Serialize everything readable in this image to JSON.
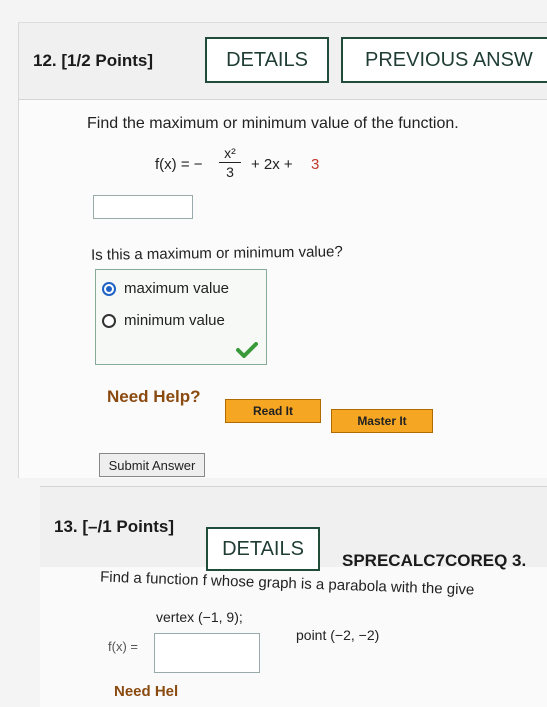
{
  "q12": {
    "label": "12. [1/2 Points]",
    "details_btn": "DETAILS",
    "previous_btn": "PREVIOUS ANSW",
    "prompt": "Find the maximum or minimum value of the function.",
    "fn_prefix": "f(x) = −",
    "fn_num": "x²",
    "fn_den": "3",
    "fn_mid": "+ 2x +",
    "fn_const": "3",
    "answer_value": "",
    "mc_question": "Is this a maximum or minimum value?",
    "options": [
      {
        "label": "maximum value",
        "selected": true
      },
      {
        "label": "minimum value",
        "selected": false
      }
    ],
    "need_help": "Need Help?",
    "read_it": "Read It",
    "master_it": "Master It",
    "submit": "Submit Answer"
  },
  "q13": {
    "label": "13. [–/1 Points]",
    "details_btn": "DETAILS",
    "course": "SPRECALC7COREQ 3.",
    "prompt": "Find a function f whose graph is a parabola with the give",
    "vertex": "vertex (−1, 9);",
    "point": "point (−2, −2)",
    "fx_label": "f(x) =",
    "answer_value": "",
    "need_help": "Need Hel"
  },
  "colors": {
    "accent": "#1f4d3a",
    "help": "#f5a623",
    "check": "#3a9a3a",
    "radio": "#1e63c5"
  }
}
